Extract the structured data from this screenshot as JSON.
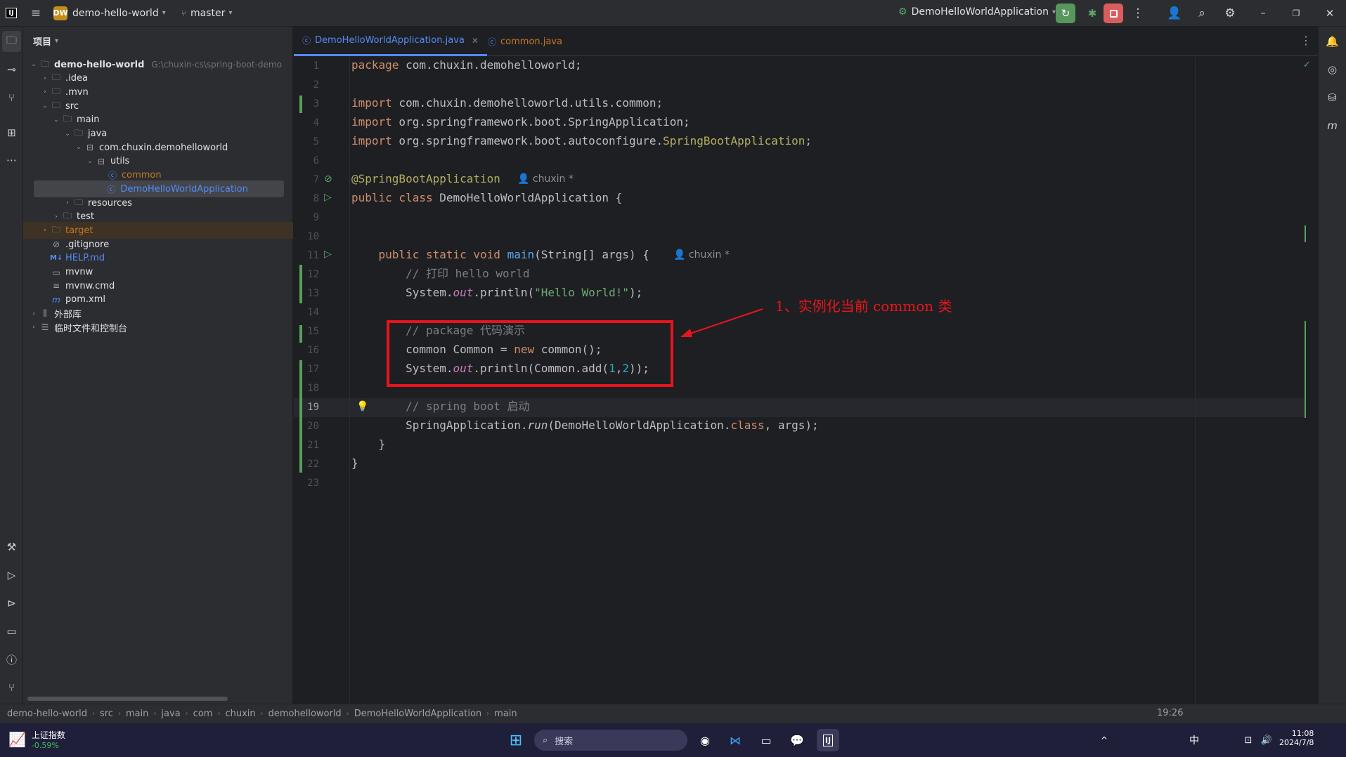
{
  "titlebar": {
    "project_badge": "DW",
    "project_name": "demo-hello-world",
    "branch": "master",
    "run_config": "DemoHelloWorldApplication"
  },
  "project_panel": {
    "title": "项目",
    "tree": [
      {
        "label": "demo-hello-world",
        "hint": "G:\\chuxin-cs\\spring-boot-demo",
        "icon": "module-folder-icon",
        "arrow": "v",
        "indent": 0
      },
      {
        "label": ".idea",
        "icon": "folder-icon",
        "arrow": ">",
        "indent": 1
      },
      {
        "label": ".mvn",
        "icon": "folder-icon",
        "arrow": ">",
        "indent": 1
      },
      {
        "label": "src",
        "icon": "folder-icon",
        "arrow": "v",
        "indent": 1
      },
      {
        "label": "main",
        "icon": "folder-icon",
        "arrow": "v",
        "indent": 2
      },
      {
        "label": "java",
        "icon": "source-folder-icon",
        "arrow": "v",
        "indent": 3
      },
      {
        "label": "com.chuxin.demohelloworld",
        "icon": "package-icon",
        "arrow": "v",
        "indent": 4
      },
      {
        "label": "utils",
        "icon": "package-icon",
        "arrow": "v",
        "indent": 5
      },
      {
        "label": "common",
        "icon": "class-icon",
        "arrow": "",
        "indent": 6,
        "color": "#c57825"
      },
      {
        "label": "DemoHelloWorldApplication",
        "icon": "spring-class-icon",
        "arrow": "",
        "indent": 5.9,
        "selected": true,
        "color": "#548af7"
      },
      {
        "label": "resources",
        "icon": "resources-folder-icon",
        "arrow": ">",
        "indent": 3
      },
      {
        "label": "test",
        "icon": "folder-icon",
        "arrow": ">",
        "indent": 2
      },
      {
        "label": "target",
        "icon": "excluded-folder-icon",
        "arrow": ">",
        "indent": 1,
        "highlight": true,
        "color": "#c57825"
      },
      {
        "label": ".gitignore",
        "icon": "ignore-file-icon",
        "arrow": "",
        "indent": 1
      },
      {
        "label": "HELP.md",
        "icon": "markdown-icon",
        "arrow": "",
        "indent": 1,
        "color": "#548af7"
      },
      {
        "label": "mvnw",
        "icon": "shell-file-icon",
        "arrow": "",
        "indent": 1
      },
      {
        "label": "mvnw.cmd",
        "icon": "text-file-icon",
        "arrow": "",
        "indent": 1
      },
      {
        "label": "pom.xml",
        "icon": "maven-icon",
        "arrow": "",
        "indent": 1
      },
      {
        "label": "外部库",
        "icon": "library-icon",
        "arrow": ">",
        "indent": 0
      },
      {
        "label": "临时文件和控制台",
        "icon": "scratch-icon",
        "arrow": ">",
        "indent": 0
      }
    ]
  },
  "tabs": [
    {
      "label": "DemoHelloWorldApplication.java",
      "active": true
    },
    {
      "label": "common.java",
      "active": false
    }
  ],
  "editor": {
    "line_numbers": [
      "1",
      "2",
      "3",
      "4",
      "5",
      "6",
      "7",
      "8",
      "9",
      "10",
      "11",
      "12",
      "13",
      "14",
      "15",
      "16",
      "17",
      "18",
      "19",
      "20",
      "21",
      "22",
      "23"
    ],
    "current_line": "19",
    "author_hint": "chuxin *"
  },
  "annotation": {
    "text": "1、实例化当前 common 类"
  },
  "statusbar": {
    "breadcrumbs": [
      "demo-hello-world",
      "src",
      "main",
      "java",
      "com",
      "chuxin",
      "demohelloworld",
      "DemoHelloWorldApplication",
      "main"
    ],
    "position": "19:26"
  },
  "taskbar": {
    "stock_name": "上证指数",
    "stock_change": "-0.59%",
    "search_placeholder": "搜索",
    "ime": "中",
    "time": "11:08",
    "date": "2024/7/8"
  },
  "colors": {
    "accent": "#548af7",
    "annotation_red": "#e8141d",
    "vcs_green": "#5a9e5d"
  }
}
